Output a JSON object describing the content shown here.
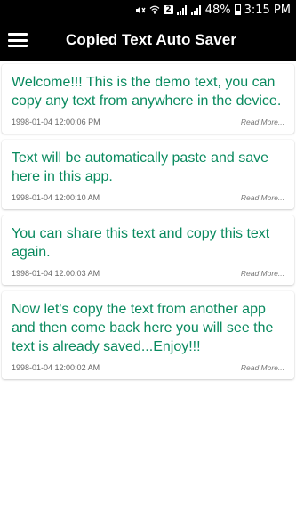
{
  "status_bar": {
    "battery": "48%",
    "time": "3:15 PM",
    "sim": "2"
  },
  "app_bar": {
    "title": "Copied Text Auto Saver"
  },
  "items": [
    {
      "text": "Welcome!!! This is the demo text, you can copy any text from anywhere in the device.",
      "date": "1998-01-04 12:00:06 PM",
      "more": "Read More..."
    },
    {
      "text": "Text will be automatically paste and save here in this app.",
      "date": "1998-01-04 12:00:10 AM",
      "more": "Read More..."
    },
    {
      "text": "You can share this text and copy this text again.",
      "date": "1998-01-04 12:00:03 AM",
      "more": "Read More..."
    },
    {
      "text": "Now let's copy the text from another app and then come back here you will see the text is already saved...Enjoy!!!",
      "date": "1998-01-04 12:00:02 AM",
      "more": "Read More..."
    }
  ],
  "colors": {
    "text_accent": "#0a8a5f",
    "app_bar_bg": "#000000"
  },
  "icons": {
    "menu": "hamburger-icon",
    "mute": "mute-icon",
    "wifi": "wifi-icon",
    "signal": "signal-icon",
    "battery": "battery-icon"
  }
}
